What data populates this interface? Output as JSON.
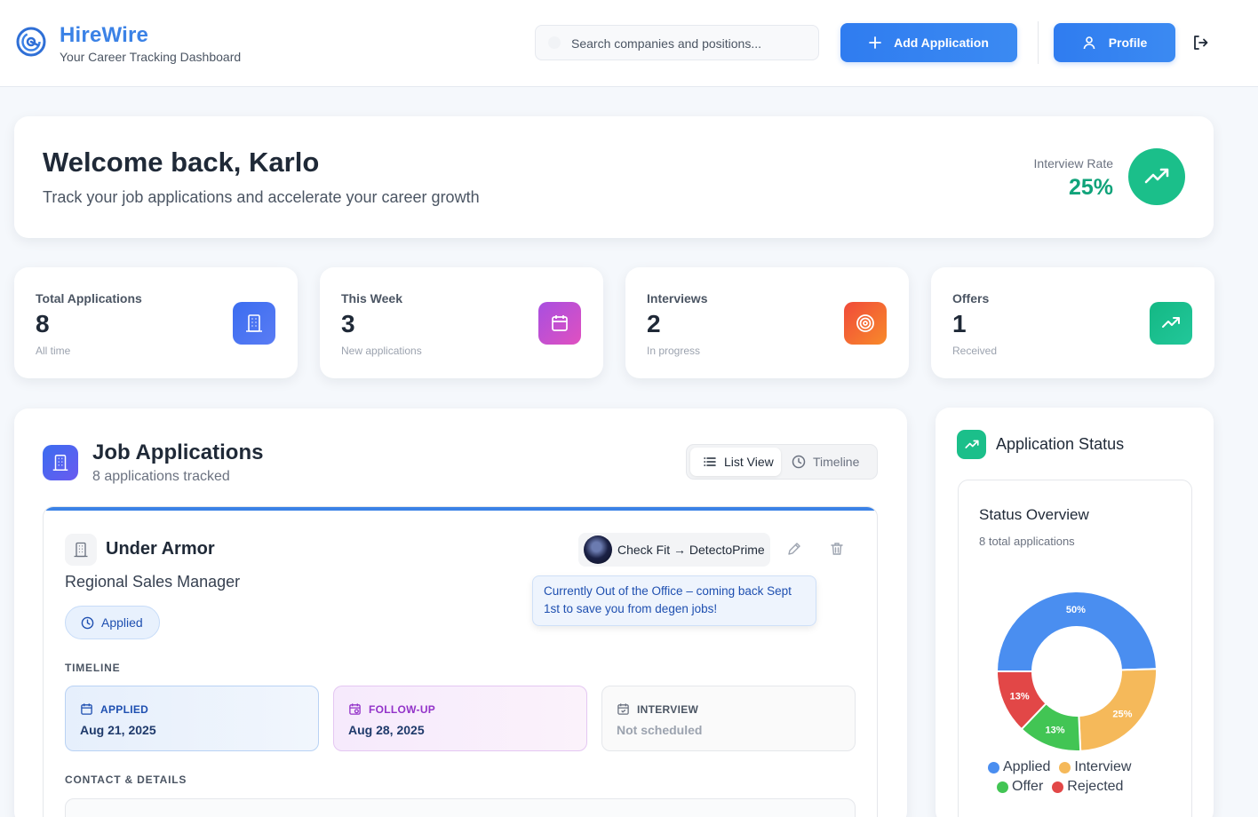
{
  "brand": {
    "name": "HireWire",
    "tagline": "Your Career Tracking Dashboard"
  },
  "header": {
    "search_placeholder": "Search companies and positions...",
    "add_label": "Add Application",
    "profile_label": "Profile"
  },
  "welcome": {
    "title": "Welcome back, Karlo",
    "subtitle": "Track your job applications and accelerate your career growth",
    "rate_label": "Interview Rate",
    "rate_value": "25%"
  },
  "stats": [
    {
      "label": "Total Applications",
      "value": "8",
      "sub": "All time",
      "icon": "building-icon",
      "color": "#3b6df0"
    },
    {
      "label": "This Week",
      "value": "3",
      "sub": "New applications",
      "icon": "calendar-icon",
      "color": "#c04fd8"
    },
    {
      "label": "Interviews",
      "value": "2",
      "sub": "In progress",
      "icon": "target-icon",
      "color": "#f2593a"
    },
    {
      "label": "Offers",
      "value": "1",
      "sub": "Received",
      "icon": "trending-up-icon",
      "color": "#1bbf8a"
    }
  ],
  "jobs": {
    "title": "Job Applications",
    "subtitle": "8 applications tracked",
    "list_view": "List View",
    "timeline_view": "Timeline",
    "application": {
      "company": "Under Armor",
      "position": "Regional Sales Manager",
      "status": "Applied",
      "check_fit": "Check Fit → DetectoPrime",
      "note": "Currently Out of the Office – coming back Sept 1st to save you from degen jobs!",
      "timeline_label": "TIMELINE",
      "timeline": [
        {
          "label": "APPLIED",
          "value": "Aug 21, 2025"
        },
        {
          "label": "FOLLOW-UP",
          "value": "Aug 28, 2025"
        },
        {
          "label": "INTERVIEW",
          "value": "Not scheduled"
        }
      ],
      "contact_label": "CONTACT & DETAILS"
    }
  },
  "status_panel": {
    "title": "Application Status",
    "overview_title": "Status Overview",
    "overview_sub": "8 total applications"
  },
  "chart_data": {
    "type": "pie",
    "title": "Status Overview",
    "categories": [
      "Applied",
      "Interview",
      "Offer",
      "Rejected"
    ],
    "values": [
      50,
      25,
      13,
      13
    ],
    "labels": [
      "50%",
      "25%",
      "13%",
      "13%"
    ],
    "colors": [
      "#4a8ef0",
      "#f5b95a",
      "#42c554",
      "#e24747"
    ],
    "legend_position": "bottom"
  }
}
